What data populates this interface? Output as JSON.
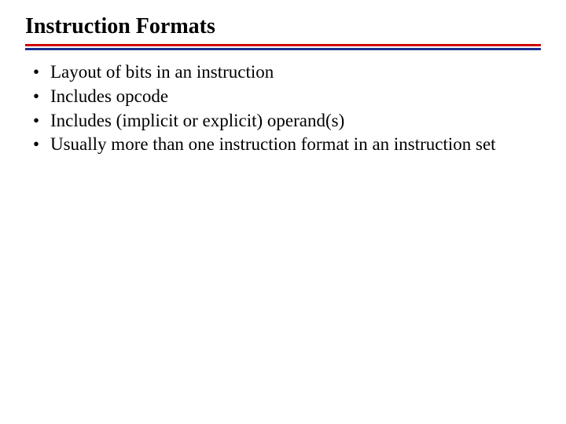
{
  "title": "Instruction Formats",
  "bullets": [
    "Layout of bits in an instruction",
    "Includes opcode",
    "Includes (implicit or explicit) operand(s)",
    "Usually more than one instruction format in an instruction set"
  ]
}
